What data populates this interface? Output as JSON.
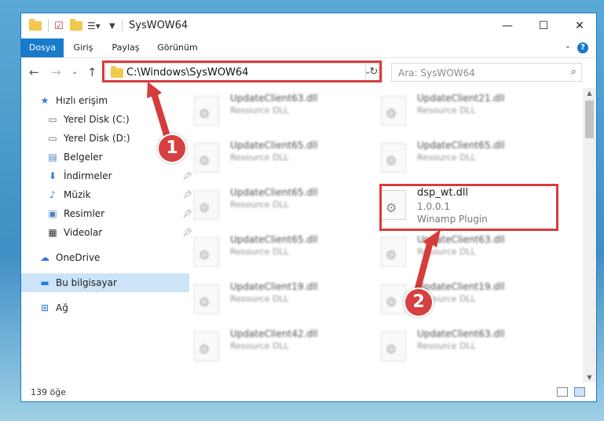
{
  "window": {
    "title": "SysWOW64"
  },
  "ribbon": {
    "tabs": [
      "Dosya",
      "Giriş",
      "Paylaş",
      "Görünüm"
    ],
    "help": "?"
  },
  "nav": {
    "address": "C:\\Windows\\SysWOW64",
    "search_placeholder": "Ara: SysWOW64"
  },
  "sidebar": {
    "items": [
      {
        "label": "Hızlı erişim",
        "icon": "star-icon"
      },
      {
        "label": "Yerel Disk (C:)",
        "icon": "drive-icon"
      },
      {
        "label": "Yerel Disk (D:)",
        "icon": "drive-icon"
      },
      {
        "label": "Belgeler",
        "icon": "documents-icon"
      },
      {
        "label": "İndirmeler",
        "icon": "download-icon"
      },
      {
        "label": "Müzik",
        "icon": "music-icon"
      },
      {
        "label": "Resimler",
        "icon": "pictures-icon"
      },
      {
        "label": "Videolar",
        "icon": "video-icon"
      },
      {
        "label": "OneDrive",
        "icon": "cloud-icon"
      },
      {
        "label": "Bu bilgisayar",
        "icon": "computer-icon"
      },
      {
        "label": "Ağ",
        "icon": "network-icon"
      }
    ]
  },
  "files": {
    "left": [
      {
        "name": "UpdateClient63.dll",
        "sub": "Resource DLL"
      },
      {
        "name": "UpdateClient65.dll",
        "sub": "Resource DLL"
      },
      {
        "name": "UpdateClient65.dll",
        "sub": "Resource DLL"
      },
      {
        "name": "UpdateClient65.dll",
        "sub": "Resource DLL"
      },
      {
        "name": "UpdateClient19.dll",
        "sub": "Resource DLL"
      },
      {
        "name": "UpdateClient42.dll",
        "sub": "Resource DLL"
      }
    ],
    "right": [
      {
        "name": "UpdateClient21.dll",
        "sub": "Resource DLL"
      },
      {
        "name": "UpdateClient65.dll",
        "sub": "Resource DLL"
      },
      {
        "name": "UpdateClient63.dll",
        "sub": "Resource DLL"
      },
      {
        "name": "UpdateClient19.dll",
        "sub": "Resource DLL"
      },
      {
        "name": "UpdateClient63.dll",
        "sub": "Resource DLL"
      }
    ],
    "highlight": {
      "name": "dsp_wt.dll",
      "version": "1.0.0.1",
      "desc": "Winamp Plugin"
    }
  },
  "status": {
    "count": "139 öğe"
  },
  "annotations": {
    "step1": "1",
    "step2": "2",
    "color": "#d63c3c"
  }
}
